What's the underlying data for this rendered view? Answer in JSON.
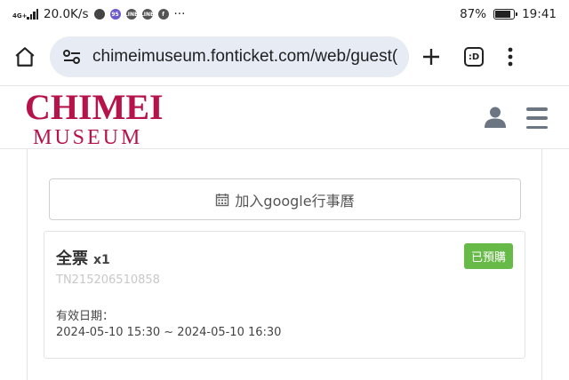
{
  "status_bar": {
    "network_type": "4G+",
    "speed": "20.0K/s",
    "more": "···",
    "battery": "87%",
    "battery_level": 0.87,
    "time": "19:41"
  },
  "browser": {
    "url": "chimeimuseum.fonticket.com/web/guest(",
    "tab_count": ":D"
  },
  "site": {
    "logo_line1": "CHIMEI",
    "logo_line2": "MUSEUM"
  },
  "calendar_button": {
    "label": "加入google行事曆"
  },
  "ticket": {
    "title": "全票",
    "quantity": "x1",
    "status": "已預購",
    "code": "TN215206510858",
    "valid_label": "有效日期：",
    "valid_range": "2024-05-10 15:30 ~ 2024-05-10 16:30"
  },
  "colors": {
    "brand": "#b5134a",
    "badge": "#67b948",
    "url_bar_bg": "#e7ebf3"
  }
}
